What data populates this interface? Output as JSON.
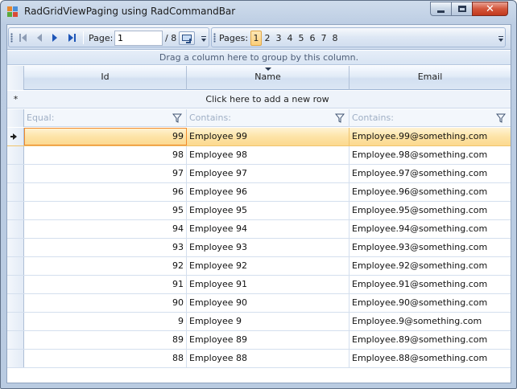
{
  "window": {
    "title": "RadGridViewPaging using RadCommandBar",
    "minimize": "",
    "maximize": "",
    "close": "✕"
  },
  "commandbar": {
    "page_label": "Page:",
    "page_value": "1",
    "page_total": "/ 8",
    "pages_label": "Pages:",
    "pages": [
      "1",
      "2",
      "3",
      "4",
      "5",
      "6",
      "7",
      "8"
    ],
    "active_page": "1",
    "icons": [
      "first-page-icon",
      "previous-page-icon",
      "next-page-icon",
      "last-page-icon",
      "go-to-page-icon",
      "overflow-icon"
    ]
  },
  "grid": {
    "group_panel_text": "Drag a column here to group by this column.",
    "columns": [
      "Id",
      "Name",
      "Email"
    ],
    "sorted_column": "Name",
    "new_row_text": "Click here to add a new row",
    "new_row_glyph": "*",
    "filters": [
      "Equal:",
      "Contains:",
      "Contains:"
    ],
    "rows": [
      {
        "id": "99",
        "name": "Employee 99",
        "email": "Employee.99@something.com"
      },
      {
        "id": "98",
        "name": "Employee 98",
        "email": "Employee.98@something.com"
      },
      {
        "id": "97",
        "name": "Employee 97",
        "email": "Employee.97@something.com"
      },
      {
        "id": "96",
        "name": "Employee 96",
        "email": "Employee.96@something.com"
      },
      {
        "id": "95",
        "name": "Employee 95",
        "email": "Employee.95@something.com"
      },
      {
        "id": "94",
        "name": "Employee 94",
        "email": "Employee.94@something.com"
      },
      {
        "id": "93",
        "name": "Employee 93",
        "email": "Employee.93@something.com"
      },
      {
        "id": "92",
        "name": "Employee 92",
        "email": "Employee.92@something.com"
      },
      {
        "id": "91",
        "name": "Employee 91",
        "email": "Employee.91@something.com"
      },
      {
        "id": "90",
        "name": "Employee 90",
        "email": "Employee.90@something.com"
      },
      {
        "id": "9",
        "name": "Employee 9",
        "email": "Employee.9@something.com"
      },
      {
        "id": "89",
        "name": "Employee 89",
        "email": "Employee.89@something.com"
      },
      {
        "id": "88",
        "name": "Employee 88",
        "email": "Employee.88@something.com"
      }
    ],
    "current_row_index": 0
  },
  "colors": {
    "accent": "#1d55b7",
    "current_row": "#fde4a7",
    "current_cell_border": "#f08a2c",
    "close_button": "#c2391d"
  }
}
